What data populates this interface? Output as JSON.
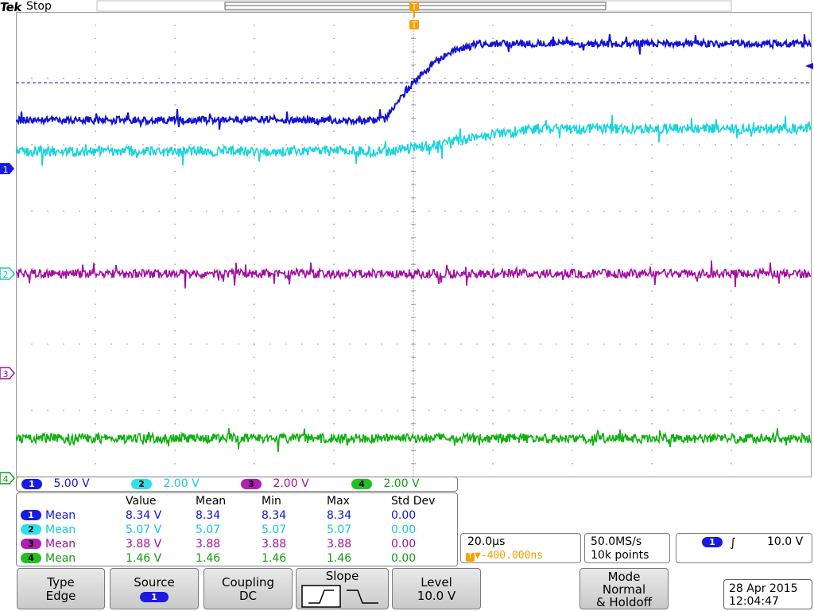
{
  "header": {
    "brand": "Tek",
    "status": "Stop"
  },
  "channels": [
    {
      "id": "1",
      "scale": "5.00 V",
      "color": "#1414d2",
      "badge_bg": "#1a1ae0"
    },
    {
      "id": "2",
      "scale": "2.00 V",
      "color": "#18d4dc",
      "badge_bg": "#30e0e8"
    },
    {
      "id": "3",
      "scale": "2.00 V",
      "color": "#a010a0",
      "badge_bg": "#b020b0"
    },
    {
      "id": "4",
      "scale": "2.00 V",
      "color": "#10b010",
      "badge_bg": "#20c020"
    }
  ],
  "marker_labels": [
    "1",
    "2",
    "3",
    "4"
  ],
  "trigger_marker": "T",
  "measurements": {
    "headers": [
      "Value",
      "Mean",
      "Min",
      "Max",
      "Std Dev"
    ],
    "rows": [
      {
        "ch": "1",
        "type": "Mean",
        "value": "8.34 V",
        "mean": "8.34",
        "min": "8.34",
        "max": "8.34",
        "std": "0.00",
        "color": "#1414d2"
      },
      {
        "ch": "2",
        "type": "Mean",
        "value": "5.07 V",
        "mean": "5.07",
        "min": "5.07",
        "max": "5.07",
        "std": "0.00",
        "color": "#18c8d0"
      },
      {
        "ch": "3",
        "type": "Mean",
        "value": "3.88 V",
        "mean": "3.88",
        "min": "3.88",
        "max": "3.88",
        "std": "0.00",
        "color": "#a010a0"
      },
      {
        "ch": "4",
        "type": "Mean",
        "value": "1.46 V",
        "mean": "1.46",
        "min": "1.46",
        "max": "1.46",
        "std": "0.00",
        "color": "#10a010"
      }
    ]
  },
  "timebase": {
    "scale": "20.0µs",
    "delay": "▼-400.000ns",
    "delay_marker": "T"
  },
  "acquisition": {
    "rate": "50.0MS/s",
    "length": "10k points"
  },
  "trigger_readout": {
    "source": "1",
    "slope_symbol": "∫",
    "level": "10.0 V"
  },
  "menu": {
    "type": {
      "title": "Type",
      "value": "Edge"
    },
    "source": {
      "title": "Source",
      "value": "1"
    },
    "coupling": {
      "title": "Coupling",
      "value": "DC"
    },
    "slope": {
      "title": "Slope"
    },
    "level": {
      "title": "Level",
      "value": "10.0 V"
    },
    "mode": {
      "line1": "Mode",
      "line2": "Normal",
      "line3": "& Holdoff"
    }
  },
  "datetime": {
    "date": "28 Apr  2015",
    "time": "12:04:47"
  },
  "colors": {
    "grid": "#9a9a9a",
    "accent_orange": "#f5a000",
    "trigger_level_line": "#1414d2"
  }
}
